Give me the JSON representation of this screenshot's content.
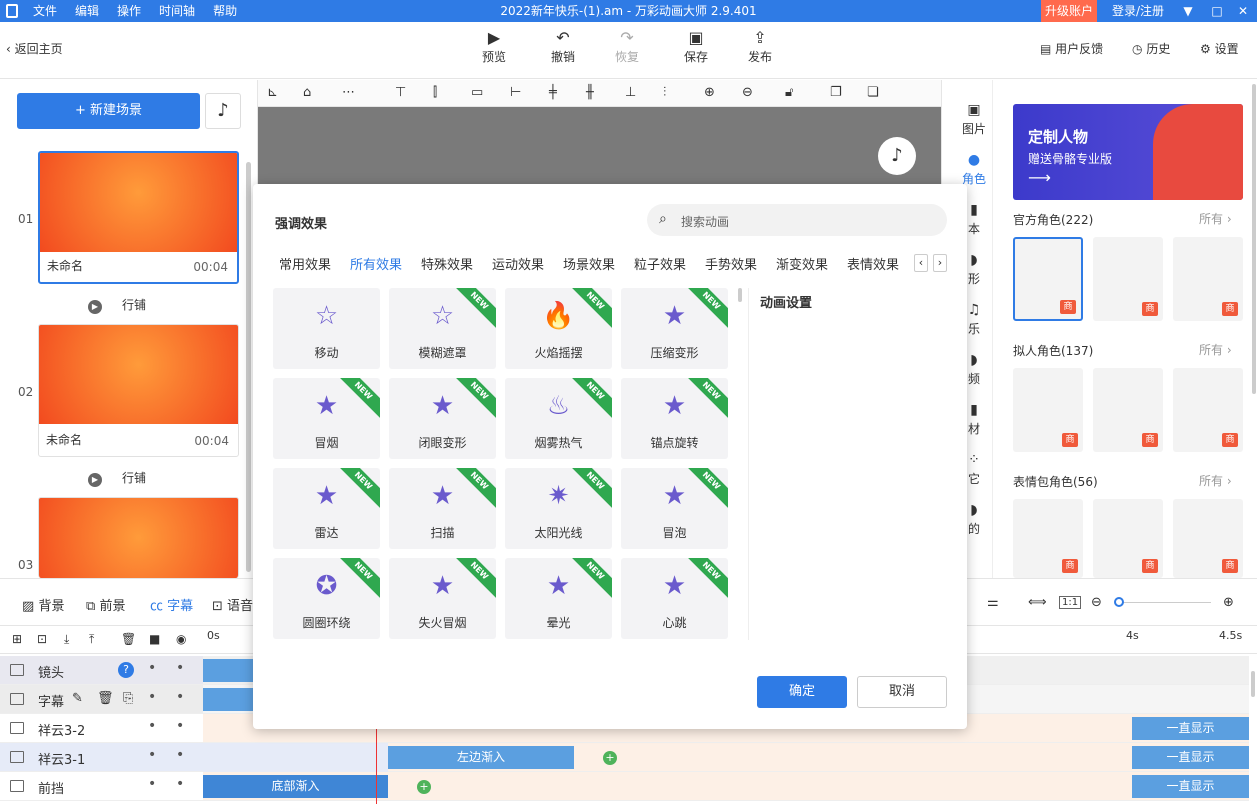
{
  "window": {
    "title": "2022新年快乐-(1).am - 万彩动画大师 2.9.401",
    "menu": [
      "文件",
      "编辑",
      "操作",
      "时间轴",
      "帮助"
    ],
    "upgrade": "升级账户",
    "login": "登录/注册",
    "controls": {
      "min": "▼",
      "restore": "□",
      "close": "✕"
    }
  },
  "toolbar": {
    "back": "返回主页",
    "preview": "预览",
    "undo": "撤销",
    "redo": "恢复",
    "save": "保存",
    "publish": "发布",
    "feedback": "用户反馈",
    "history": "历史",
    "settings": "设置"
  },
  "left": {
    "new_scene": "+ 新建场景",
    "scenes": [
      {
        "num": "01",
        "name": "未命名",
        "duration": "00:04",
        "transition": "行铺"
      },
      {
        "num": "02",
        "name": "未命名",
        "duration": "00:04",
        "transition": "行铺"
      },
      {
        "num": "03"
      }
    ]
  },
  "right_nav": [
    "图片",
    "角色",
    "本",
    "形",
    "乐",
    "频",
    "材",
    "它",
    "的"
  ],
  "right_panel": {
    "banner_title": "定制人物",
    "banner_sub": "赠送骨骼专业版",
    "banner_arrow": "⟶",
    "sections": [
      {
        "title": "官方角色(222)",
        "more": "所有 ›"
      },
      {
        "title": "拟人角色(137)",
        "more": "所有 ›"
      },
      {
        "title": "表情包角色(56)",
        "more": "所有 ›"
      }
    ],
    "badge": "商"
  },
  "bottom_tabs": [
    "背景",
    "前景",
    "字幕",
    "语音"
  ],
  "timeline": {
    "ruler": [
      "0s",
      "4s",
      "4.5s"
    ],
    "tracks": [
      {
        "name": "镜头"
      },
      {
        "name": "字幕"
      },
      {
        "name": "祥云3-2"
      },
      {
        "name": "祥云3-1"
      },
      {
        "name": "前挡"
      }
    ],
    "clips": {
      "left_in": "左边渐入",
      "bottom_in": "底部渐入",
      "always": "一直显示"
    }
  },
  "dialog": {
    "title": "强调效果",
    "search_placeholder": "搜索动画",
    "tabs": [
      "常用效果",
      "所有效果",
      "特殊效果",
      "运动效果",
      "场景效果",
      "粒子效果",
      "手势效果",
      "渐变效果",
      "表情效果"
    ],
    "active_tab": "所有效果",
    "effects": [
      {
        "label": "移动",
        "icon": "☆",
        "new": false
      },
      {
        "label": "模糊遮罩",
        "icon": "☆",
        "new": true
      },
      {
        "label": "火焰摇摆",
        "icon": "🔥",
        "new": true
      },
      {
        "label": "压缩变形",
        "icon": "★",
        "new": true
      },
      {
        "label": "冒烟",
        "icon": "★",
        "new": true
      },
      {
        "label": "闭眼变形",
        "icon": "★",
        "new": true
      },
      {
        "label": "烟雾热气",
        "icon": "♨",
        "new": true
      },
      {
        "label": "锚点旋转",
        "icon": "★",
        "new": true
      },
      {
        "label": "雷达",
        "icon": "★",
        "new": true
      },
      {
        "label": "扫描",
        "icon": "★",
        "new": true
      },
      {
        "label": "太阳光线",
        "icon": "✷",
        "new": true
      },
      {
        "label": "冒泡",
        "icon": "★",
        "new": true
      },
      {
        "label": "圆圈环绕",
        "icon": "✪",
        "new": true
      },
      {
        "label": "失火冒烟",
        "icon": "★",
        "new": true
      },
      {
        "label": "晕光",
        "icon": "★",
        "new": true
      },
      {
        "label": "心跳",
        "icon": "★",
        "new": true
      }
    ],
    "new_badge": "NEW",
    "settings_title": "动画设置",
    "ok": "确定",
    "cancel": "取消"
  }
}
